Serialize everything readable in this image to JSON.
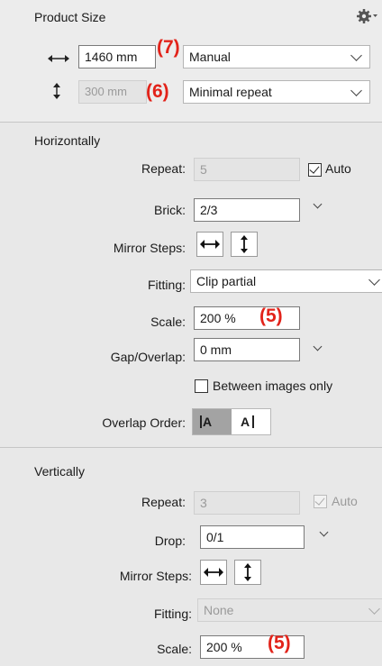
{
  "product_size": {
    "title": "Product Size",
    "width": {
      "icon": "horizontal-arrow-icon",
      "value": "1460 mm",
      "badge": "(7)",
      "mode": "Manual"
    },
    "height": {
      "icon": "vertical-arrow-icon",
      "value": "300 mm",
      "badge": "(6)",
      "mode": "Minimal repeat"
    }
  },
  "horizontally": {
    "title": "Horizontally",
    "repeat_label": "Repeat:",
    "repeat_value": "5",
    "auto_label": "Auto",
    "auto_checked": true,
    "brick_label": "Brick:",
    "brick_value": "2/3",
    "mirror_label": "Mirror Steps:",
    "fitting_label": "Fitting:",
    "fitting_value": "Clip partial",
    "scale_label": "Scale:",
    "scale_value": "200 %",
    "scale_badge": "(5)",
    "gap_label": "Gap/Overlap:",
    "gap_value": "0 mm",
    "between_label": "Between images only",
    "between_checked": false,
    "overlap_label": "Overlap Order:",
    "overlap_opt1": "A",
    "overlap_opt2": "A"
  },
  "vertically": {
    "title": "Vertically",
    "repeat_label": "Repeat:",
    "repeat_value": "3",
    "auto_label": "Auto",
    "auto_checked": true,
    "drop_label": "Drop:",
    "drop_value": "0/1",
    "mirror_label": "Mirror Steps:",
    "fitting_label": "Fitting:",
    "fitting_value": "None",
    "scale_label": "Scale:",
    "scale_value": "200 %",
    "scale_badge": "(5)"
  },
  "colors": {
    "badge": "#e2231a",
    "panel": "#e8e8e8"
  }
}
